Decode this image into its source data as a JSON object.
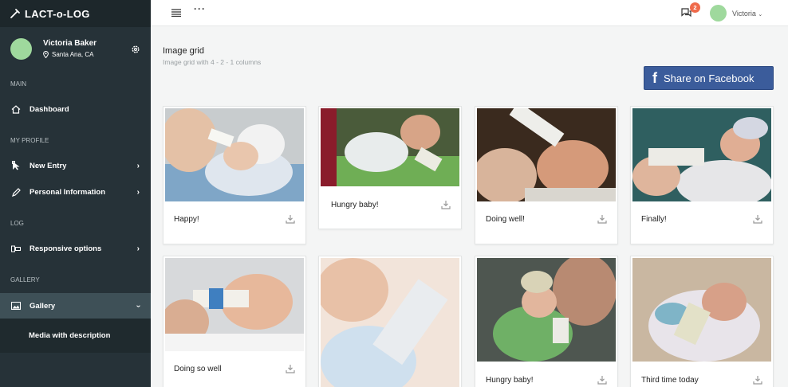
{
  "brand": {
    "name": "LACT-o-LOG"
  },
  "profile": {
    "name": "Victoria Baker",
    "location": "Santa Ana, CA"
  },
  "sidebar": {
    "sections": [
      "MAIN",
      "MY PROFILE",
      "LOG",
      "GALLERY"
    ],
    "items": [
      {
        "label": "Dashboard",
        "icon": "home-icon"
      },
      {
        "label": "New Entry",
        "icon": "cursor-icon"
      },
      {
        "label": "Personal Information",
        "icon": "pencil-icon"
      },
      {
        "label": "Responsive options",
        "icon": "responsive-icon"
      },
      {
        "label": "Gallery",
        "icon": "image-icon"
      }
    ],
    "submenu": {
      "label": "Media with description"
    }
  },
  "topbar": {
    "notifications": "2",
    "user": "Victoria"
  },
  "page": {
    "title": "Image grid",
    "subtitle": "Image grid with 4 - 2 - 1 columns"
  },
  "facebook": {
    "label": "Share on Facebook",
    "color": "#3b5c9b"
  },
  "cards": [
    {
      "caption": "Happy!"
    },
    {
      "caption": "Hungry baby!"
    },
    {
      "caption": "Doing well!"
    },
    {
      "caption": "Finally!"
    },
    {
      "caption": "Doing so well"
    },
    {
      "caption": ""
    },
    {
      "caption": "Hungry baby!"
    },
    {
      "caption": "Third time today"
    }
  ]
}
